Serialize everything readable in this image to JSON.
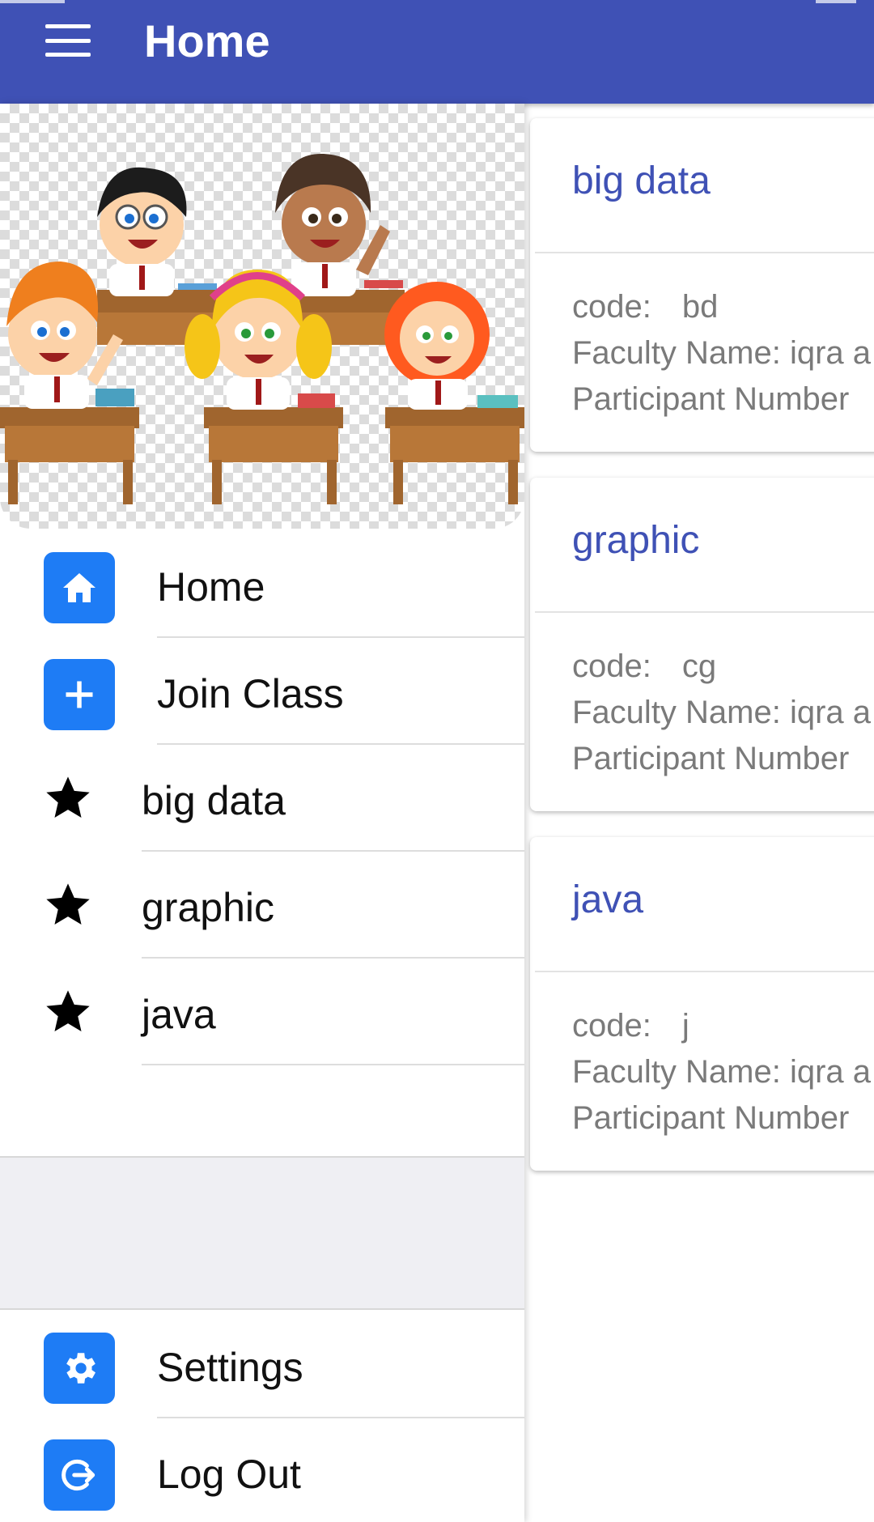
{
  "app_bar": {
    "title": "Home",
    "menu_icon": "hamburger-menu-icon",
    "color": "#3f51b5"
  },
  "drawer": {
    "header_image": "cartoon-kids-in-classroom",
    "nav_items": [
      {
        "label": "Home",
        "icon": "home-icon"
      },
      {
        "label": "Join Class",
        "icon": "plus-icon"
      }
    ],
    "classes": [
      {
        "label": "big data",
        "icon": "star-icon"
      },
      {
        "label": "graphic",
        "icon": "star-icon"
      },
      {
        "label": "java",
        "icon": "star-icon"
      }
    ],
    "footer_items": [
      {
        "label": "Settings",
        "icon": "gear-icon"
      },
      {
        "label": "Log Out",
        "icon": "logout-icon"
      }
    ],
    "icon_color": "#1e7cf5"
  },
  "cards": [
    {
      "title": "big data",
      "code_label": "code:",
      "code": "bd",
      "faculty": "Faculty Name: iqra a",
      "participants": "Participant Number"
    },
    {
      "title": "graphic",
      "code_label": "code:",
      "code": "cg",
      "faculty": "Faculty Name: iqra a",
      "participants": "Participant Number"
    },
    {
      "title": "java",
      "code_label": "code:",
      "code": "j",
      "faculty": "Faculty Name: iqra a",
      "participants": "Participant Number"
    }
  ]
}
